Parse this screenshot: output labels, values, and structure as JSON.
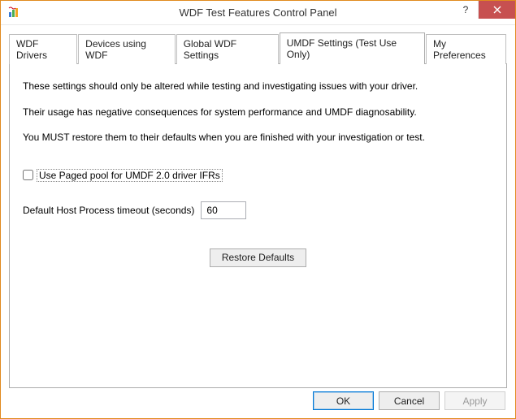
{
  "window": {
    "title": "WDF Test Features Control Panel"
  },
  "tabs": [
    {
      "label": "WDF Drivers"
    },
    {
      "label": "Devices using WDF"
    },
    {
      "label": "Global WDF Settings"
    },
    {
      "label": "UMDF Settings (Test Use Only)"
    },
    {
      "label": "My Preferences"
    }
  ],
  "panel": {
    "para1": "These settings should only be altered while testing and investigating issues with your driver.",
    "para2": "Their usage has negative consequences for system performance and UMDF diagnosability.",
    "para3": "You MUST restore them to their defaults when you are finished with your investigation or test.",
    "checkbox_label": "Use Paged pool for UMDF 2.0 driver IFRs",
    "checkbox_checked": false,
    "timeout_label": "Default Host Process timeout (seconds)",
    "timeout_value": "60",
    "restore_btn": "Restore Defaults"
  },
  "buttons": {
    "ok": "OK",
    "cancel": "Cancel",
    "apply": "Apply"
  }
}
